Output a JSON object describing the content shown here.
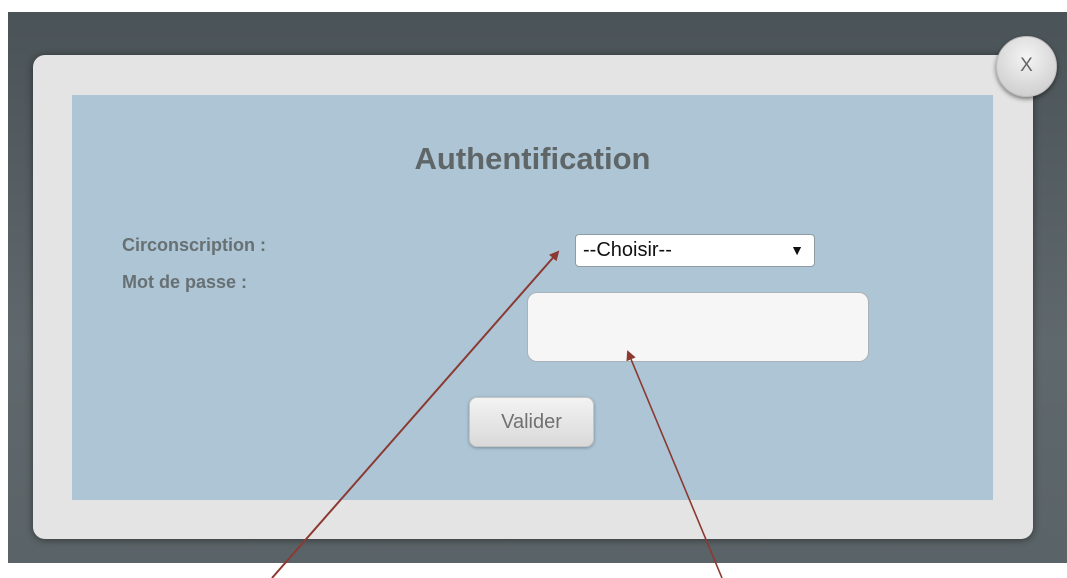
{
  "modal": {
    "title": "Authentification",
    "close_label": "X"
  },
  "form": {
    "circonscription_label": "Circonscription :",
    "password_label": "Mot de passe :",
    "select_value": "--Choisir--",
    "select_arrow": "▼",
    "password_value": "",
    "submit_label": "Valider"
  },
  "colors": {
    "backdrop": "#5a6367",
    "modal_bg": "#e4e4e4",
    "panel_bg": "#adc5d5",
    "annotation_arrow": "#8b3a32"
  },
  "icons": {
    "close": "close-icon",
    "dropdown": "chevron-down-icon"
  }
}
